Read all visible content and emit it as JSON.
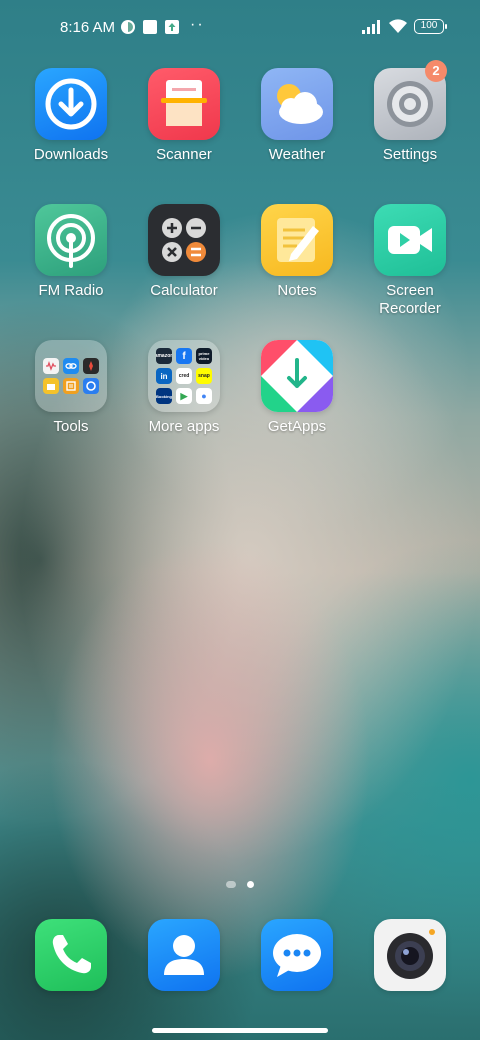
{
  "status_bar": {
    "time": "8:16 AM",
    "battery": "100",
    "overflow": "··"
  },
  "apps": {
    "downloads": "Downloads",
    "scanner": "Scanner",
    "weather": "Weather",
    "settings": "Settings",
    "settings_badge": "2",
    "fm_radio": "FM Radio",
    "calculator": "Calculator",
    "notes": "Notes",
    "screen_recorder": "Screen Recorder",
    "tools": "Tools",
    "more_apps": "More apps",
    "getapps": "GetApps"
  },
  "folder_more_apps": {
    "amazon": "amazon",
    "facebook": "f",
    "prime": "prime video",
    "linkedin": "in",
    "cred": "cred",
    "snap": "snap",
    "booking": "Booking",
    "play": "▶",
    "assistant": "●"
  },
  "pages": {
    "count": 2,
    "current": 2
  }
}
